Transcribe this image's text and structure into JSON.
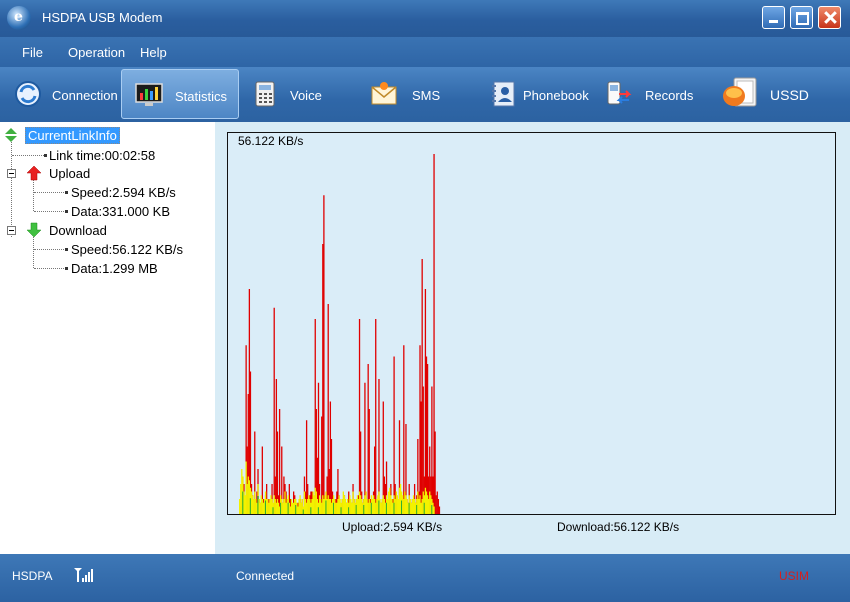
{
  "window": {
    "title": "HSDPA USB Modem"
  },
  "menu": [
    "File",
    "Operation",
    "Help"
  ],
  "toolbar": [
    {
      "label": "Connection",
      "icon": "connection-icon"
    },
    {
      "label": "Statistics",
      "icon": "statistics-icon",
      "active": true
    },
    {
      "label": "Voice",
      "icon": "phone-icon"
    },
    {
      "label": "SMS",
      "icon": "envelope-icon"
    },
    {
      "label": "Phonebook",
      "icon": "phonebook-icon"
    },
    {
      "label": "Records",
      "icon": "records-icon"
    },
    {
      "label": "USSD",
      "icon": "ussd-icon"
    }
  ],
  "tree": {
    "root": "CurrentLinkInfo",
    "link_time": "Link time:00:02:58",
    "upload": {
      "label": "Upload",
      "speed": "Speed:2.594 KB/s",
      "data": "Data:331.000 KB"
    },
    "download": {
      "label": "Download",
      "speed": "Speed:56.122 KB/s",
      "data": "Data:1.299 MB"
    }
  },
  "graph": {
    "peak_label": "56.122 KB/s",
    "upload_legend": "Upload:2.594 KB/s",
    "download_legend": "Download:56.122 KB/s"
  },
  "chart_data": {
    "type": "bar",
    "max": 56.122,
    "download_color": "#e00000",
    "upload_color": "#f2f200",
    "green_color": "#30b030",
    "download": [
      0,
      2,
      5,
      10,
      8,
      3,
      45,
      18,
      32,
      60,
      38,
      8,
      5,
      3,
      22,
      4,
      6,
      12,
      4,
      3,
      2,
      18,
      4,
      2,
      5,
      8,
      3,
      4,
      4,
      2,
      8,
      2,
      55,
      10,
      36,
      22,
      5,
      28,
      4,
      18,
      3,
      10,
      8,
      6,
      4,
      2,
      8,
      4,
      3,
      2,
      6,
      5,
      3,
      2,
      3,
      2,
      4,
      3,
      4,
      2,
      10,
      6,
      25,
      8,
      3,
      5,
      6,
      6,
      4,
      3,
      52,
      28,
      15,
      35,
      8,
      2,
      26,
      72,
      85,
      4,
      6,
      10,
      56,
      12,
      30,
      20,
      6,
      4,
      3,
      4,
      6,
      12,
      5,
      3,
      2,
      4,
      3,
      5,
      2,
      3,
      3,
      6,
      4,
      2,
      3,
      8,
      4,
      2,
      4,
      3,
      5,
      52,
      22,
      6,
      3,
      4,
      35,
      6,
      3,
      40,
      28,
      4,
      4,
      3,
      6,
      18,
      52,
      4,
      2,
      36,
      3,
      3,
      4,
      30,
      10,
      8,
      14,
      4,
      3,
      4,
      8,
      4,
      4,
      42,
      8,
      6,
      3,
      3,
      25,
      5,
      3,
      4,
      45,
      5,
      24,
      4,
      3,
      8,
      3,
      3,
      4,
      3,
      8,
      3,
      5,
      20,
      6,
      45,
      30,
      68,
      34,
      10,
      60,
      42,
      40,
      10,
      18,
      10,
      34,
      10,
      96,
      22,
      5,
      6,
      4,
      2
    ],
    "upload": [
      4,
      8,
      12,
      10,
      6,
      5,
      14,
      8,
      10,
      9,
      7,
      6,
      5,
      4,
      6,
      4,
      3,
      8,
      4,
      3,
      5,
      4,
      3,
      4,
      6,
      4,
      4,
      3,
      4,
      5,
      4,
      3,
      5,
      4,
      3,
      4,
      3,
      2,
      5,
      4,
      3,
      4,
      6,
      3,
      4,
      5,
      3,
      2,
      4,
      3,
      3,
      4,
      4,
      3,
      2,
      4,
      5,
      3,
      4,
      2,
      6,
      4,
      3,
      4,
      5,
      4,
      3,
      4,
      6,
      5,
      7,
      6,
      4,
      3,
      5,
      4,
      3,
      5,
      4,
      5,
      6,
      4,
      5,
      4,
      4,
      3,
      4,
      5,
      4,
      3,
      3,
      4,
      5,
      4,
      3,
      4,
      6,
      5,
      4,
      3,
      4,
      3,
      5,
      4,
      3,
      6,
      4,
      3,
      4,
      5,
      4,
      6,
      5,
      4,
      3,
      4,
      5,
      6,
      4,
      3,
      4,
      3,
      5,
      4,
      5,
      4,
      3,
      4,
      5,
      6,
      4,
      3,
      4,
      5,
      4,
      3,
      5,
      4,
      6,
      7,
      5,
      4,
      3,
      5,
      4,
      6,
      5,
      4,
      7,
      8,
      6,
      5,
      4,
      6,
      5,
      4,
      3,
      5,
      4,
      3,
      4,
      5,
      4,
      3,
      4,
      6,
      4,
      5,
      3,
      4,
      6,
      5,
      7,
      6,
      5,
      4,
      6,
      5,
      4,
      3,
      2
    ]
  },
  "status": {
    "network": "HSDPA",
    "connection": "Connected",
    "sim": "USIM",
    "sim_color": "#d42020"
  }
}
